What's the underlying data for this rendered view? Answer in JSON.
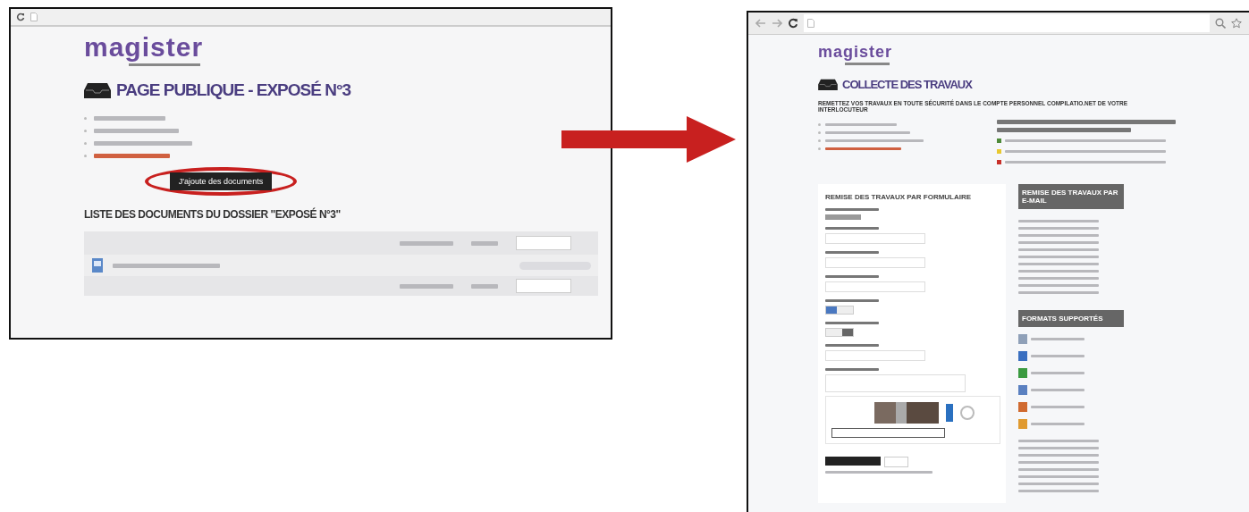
{
  "left_window": {
    "logo": "magister",
    "page_title": "PAGE PUBLIQUE - EXPOSÉ N°3",
    "info_items": [
      {
        "kind": "normal"
      },
      {
        "kind": "normal"
      },
      {
        "kind": "normal"
      },
      {
        "kind": "deadline"
      }
    ],
    "add_button": "J'ajoute des documents",
    "list_title": "LISTE DES DOCUMENTS DU DOSSIER \"EXPOSÉ N°3\""
  },
  "right_window": {
    "logo": "magister",
    "page_title": "COLLECTE DES TRAVAUX",
    "intro": "REMETTEZ VOS TRAVAUX EN TOUTE SÉCURITÉ DANS LE COMPTE PERSONNEL COMPILATIO.NET DE VOTRE INTERLOCUTEUR",
    "info_items": [
      {
        "kind": "normal"
      },
      {
        "kind": "normal"
      },
      {
        "kind": "normal"
      },
      {
        "kind": "deadline"
      }
    ],
    "legend": [
      {
        "color": "#4e8a3a"
      },
      {
        "color": "#e8c830"
      },
      {
        "color": "#c8302a"
      }
    ],
    "form_title": "REMISE DES TRAVAUX PAR FORMULAIRE",
    "fields": [
      {
        "kind": "file"
      },
      {
        "kind": "input"
      },
      {
        "kind": "input"
      },
      {
        "kind": "input"
      },
      {
        "kind": "toggle",
        "on": true
      },
      {
        "kind": "toggle",
        "on": false
      },
      {
        "kind": "input"
      },
      {
        "kind": "textarea"
      }
    ],
    "email_title": "REMISE DES TRAVAUX PAR E-MAIL",
    "formats_title": "FORMATS SUPPORTÉS",
    "formats": [
      {
        "color": "#8fa0b8"
      },
      {
        "color": "#3a6fc0"
      },
      {
        "color": "#3a9a40"
      },
      {
        "color": "#5a80c0"
      },
      {
        "color": "#d06a30"
      },
      {
        "color": "#e09a30"
      }
    ]
  }
}
